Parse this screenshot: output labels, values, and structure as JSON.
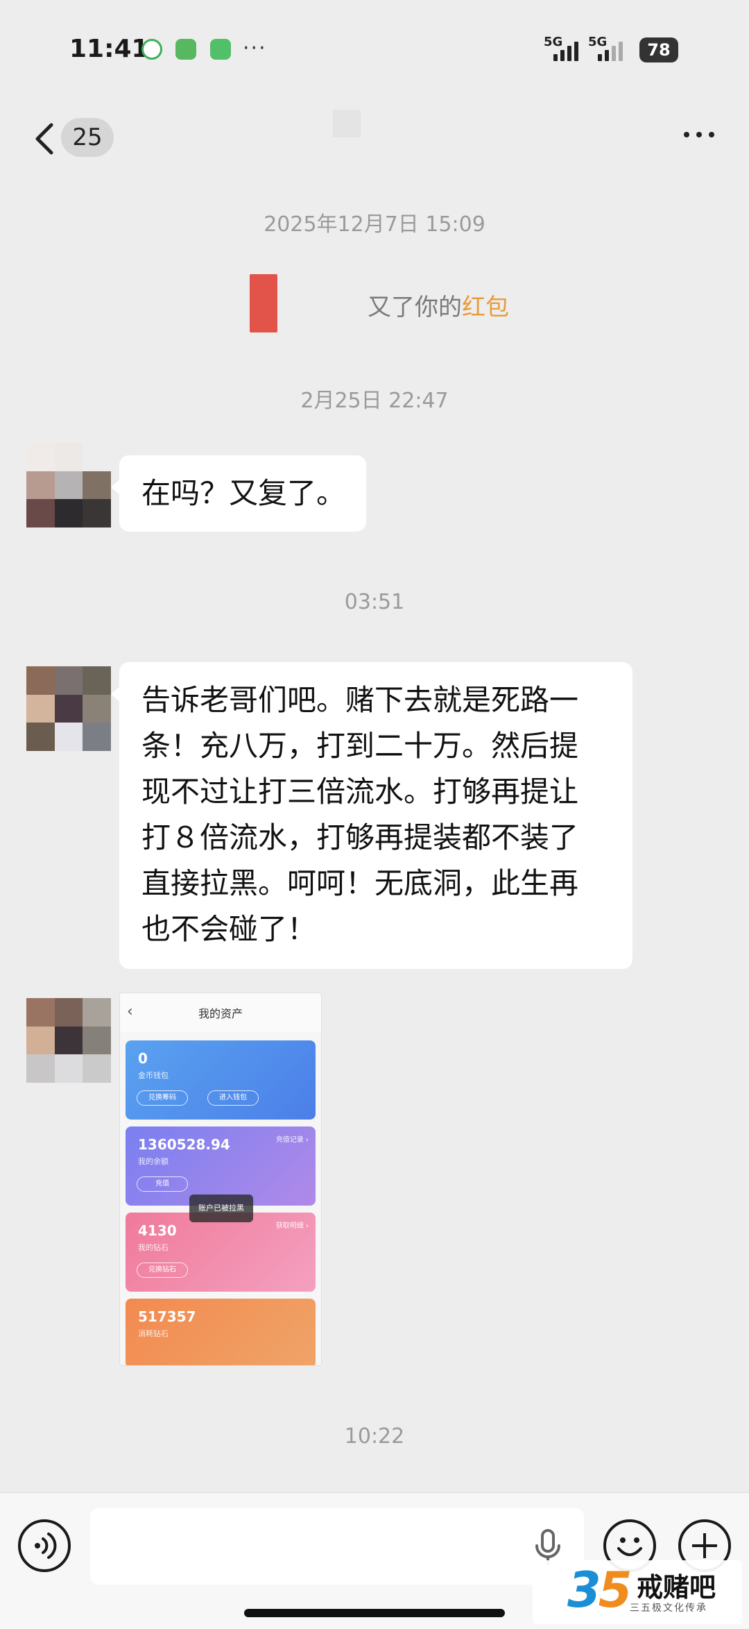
{
  "status_bar": {
    "time": "11:41",
    "more": "···",
    "signal1": "5G",
    "signal2": "5G",
    "battery": "78"
  },
  "nav": {
    "unread_count": "25"
  },
  "messages": {
    "timestamp1": "2025年12月7日 15:09",
    "system_text_prefix": "又了你的",
    "system_text_highlight": "红包",
    "timestamp2": "2月25日 22:47",
    "msg1": "在吗？又复了。",
    "timestamp3": "03:51",
    "msg2_lines": [
      "告诉老哥们吧。赌下去就是死路一",
      "条！充八万，打到二十万。然后提",
      "现不过让打三倍流水。打够再提让",
      "打８倍流水，打够再提装都不装了",
      "直接拉黑。呵呵！无底洞，此生再",
      "也不会碰了！"
    ],
    "timestamp4": "10:22"
  },
  "image_message": {
    "title": "我的资产",
    "card1": {
      "amount": "0",
      "sub": "金币钱包",
      "btn1": "兑换筹码",
      "btn2": "进入钱包"
    },
    "card2": {
      "amount": "1360528.94",
      "sub": "我的余额",
      "link": "充值记录 ›",
      "btn1": "充值"
    },
    "toast": "账户已被拉黑",
    "card3": {
      "amount": "4130",
      "sub": "我的钻石",
      "link": "获取明细 ›",
      "btn1": "兑换钻石"
    },
    "card4": {
      "amount": "517357",
      "sub": "消耗钻石"
    }
  },
  "watermark": {
    "num_3": "3",
    "num_5": "5",
    "name": "戒赌吧",
    "subtitle": "三五极文化传承"
  },
  "colors": {
    "background": "#ededed",
    "bubble": "#ffffff",
    "highlight": "#e89b3a",
    "redpacket": "#e2544a"
  }
}
